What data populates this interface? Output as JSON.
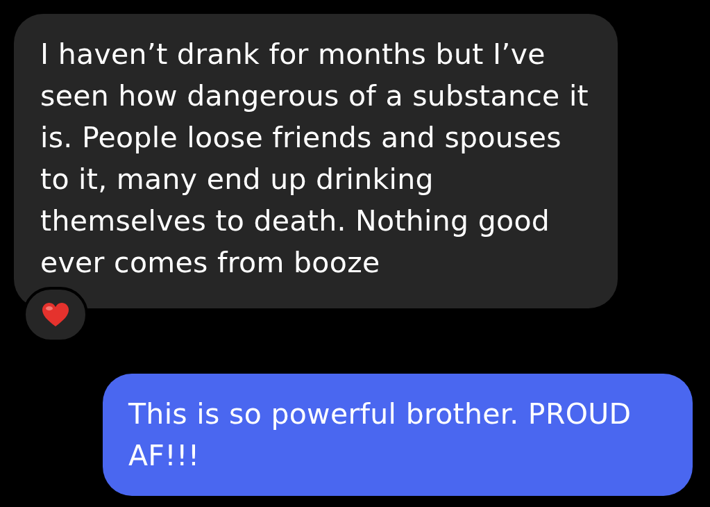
{
  "messages": [
    {
      "kind": "incoming",
      "text": "I haven’t drank for months but I’ve seen how dangerous of a substance it is. People loose friends and spouses to it, many end up drinking themselves to death. Nothing good ever comes from booze",
      "reacted": true
    },
    {
      "kind": "outgoing",
      "text": "This is so powerful brother. PROUD AF!!!",
      "reacted": false
    }
  ]
}
